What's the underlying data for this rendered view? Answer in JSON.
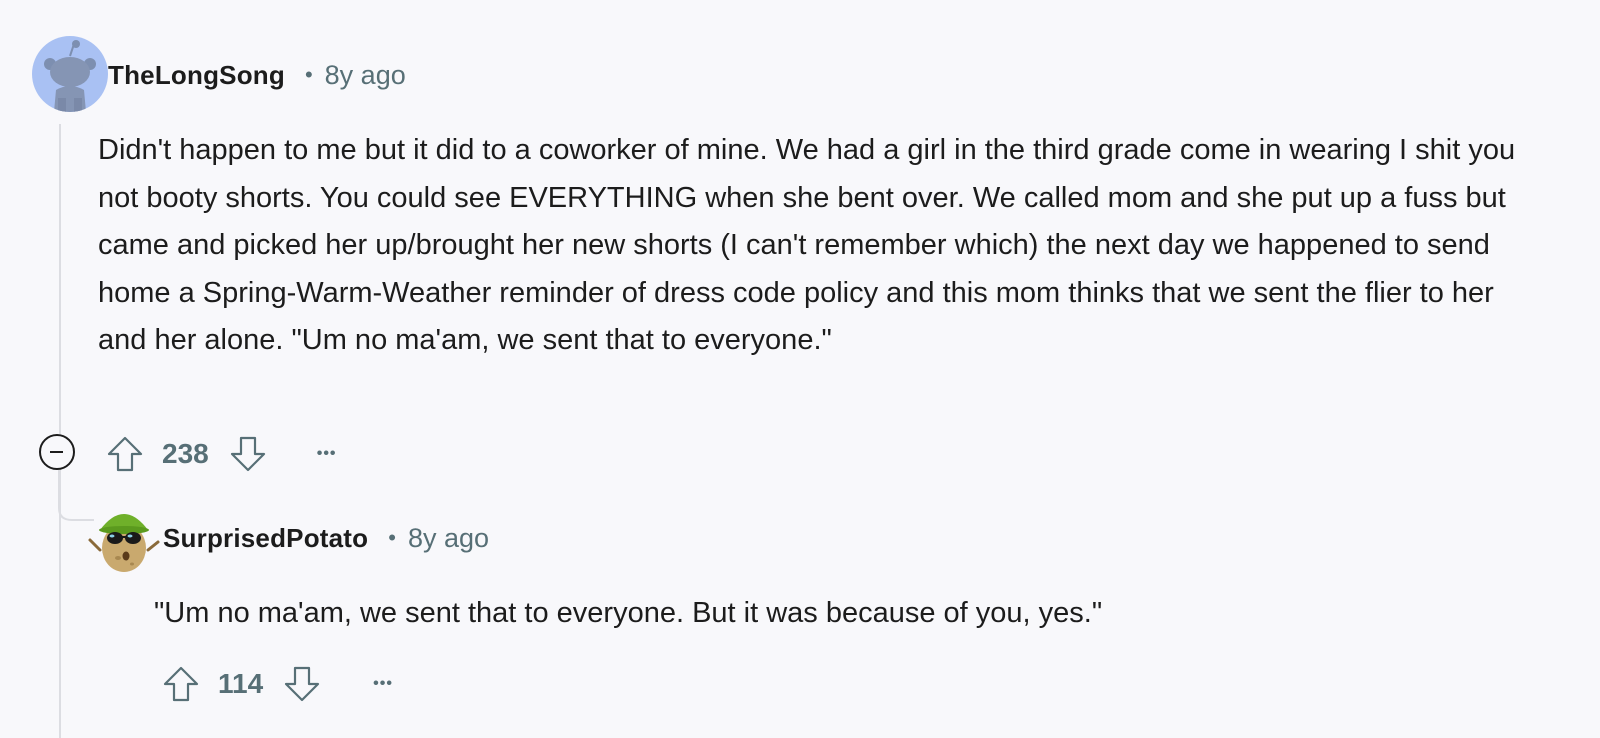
{
  "comments": [
    {
      "username": "TheLongSong",
      "separator": "•",
      "timestamp": "8y ago",
      "body": "Didn't happen to me but it did to a coworker of mine. We had a girl in the third grade come in wearing I shit you not booty shorts. You could see EVERYTHING when she bent over. We called mom and she put up a fuss but came and picked her up/brought her new shorts (I can't remember which) the next day we happened to send home a Spring-Warm-Weather reminder of dress code policy and this mom thinks that we sent the flier to her and her alone. \"Um no ma'am, we sent that to everyone.\"",
      "score": "238",
      "more": "•••",
      "avatar_icon": "snoo-avatar-icon"
    },
    {
      "username": "SurprisedPotato",
      "separator": "•",
      "timestamp": "8y ago",
      "body": "\"Um no ma'am, we sent that to everyone. But it was because of you, yes.\"",
      "score": "114",
      "more": "•••",
      "avatar_icon": "potato-avatar-icon"
    }
  ],
  "colors": {
    "background": "#f8f8fb",
    "text": "#1c1c1c",
    "meta": "#576f76",
    "thread_line": "#dcdde2",
    "avatar_bg": "#a9c1f3"
  }
}
